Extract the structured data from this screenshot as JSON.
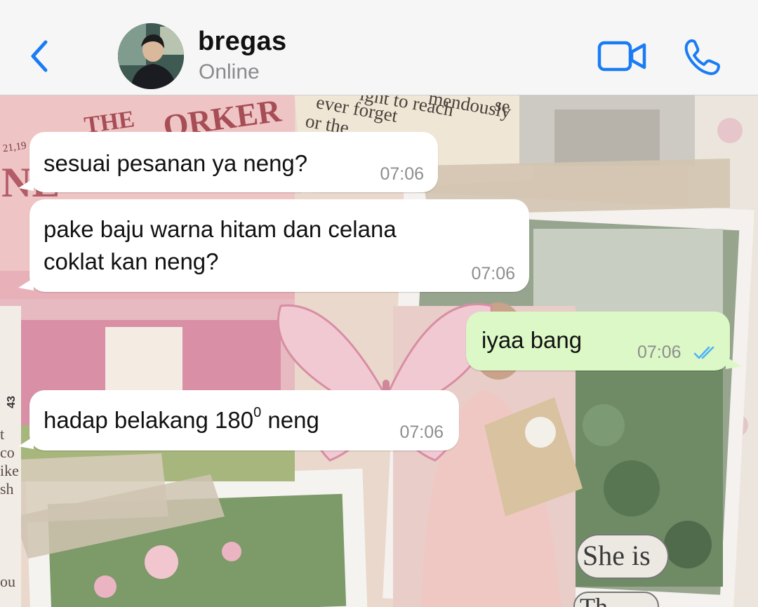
{
  "header": {
    "contact_name": "bregas",
    "status": "Online",
    "accent_color": "#1a7cf5"
  },
  "messages": [
    {
      "direction": "in",
      "text": "sesuai pesanan ya neng?",
      "time": "07:06"
    },
    {
      "direction": "in",
      "text_line1": "pake baju warna hitam dan celana",
      "text_line2": "coklat kan neng?",
      "time": "07:06"
    },
    {
      "direction": "out",
      "text": "iyaa bang",
      "time": "07:06",
      "status_icon": "double-check-read"
    },
    {
      "direction": "in",
      "text_before": "hadap belakang 180",
      "text_sup": "0",
      "text_after": " neng",
      "time": "07:06"
    }
  ],
  "wallpaper": {
    "newspaper_title": "THE",
    "newspaper_sub": "ORKER",
    "newspaper_date": "21,19",
    "newspaper_side_letters": "NE",
    "book_line1": "ever forget",
    "book_line2": "ight to reach",
    "book_line3": "mendously",
    "book_line4": "or the",
    "book_side": "se",
    "page_number": "43",
    "left_margin_text": "t co ike sh",
    "bottom_left_text": "ou",
    "sticker_line1": "She is",
    "sticker_line2": "Th"
  }
}
